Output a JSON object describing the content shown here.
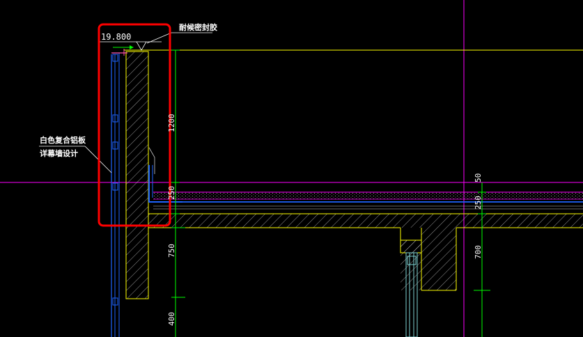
{
  "drawing": {
    "elevation_label": "19.800",
    "annotation_top": "耐候密封胶",
    "annotation_left_line1": "白色复合铝板",
    "annotation_left_line2": "详幕墙设计",
    "dimensions": {
      "d1200": "1200",
      "d250_upper": "250",
      "d50": "50",
      "d250_right": "250",
      "d750": "750",
      "d700": "700",
      "d400": "400"
    }
  },
  "colors": {
    "background": "#000000",
    "yellow": "#ffff00",
    "green": "#00ff00",
    "magenta": "#ff00ff",
    "blue": "#1e64ff",
    "white": "#ffffff",
    "red": "#ff0000",
    "cyan": "#7fd3d3"
  }
}
